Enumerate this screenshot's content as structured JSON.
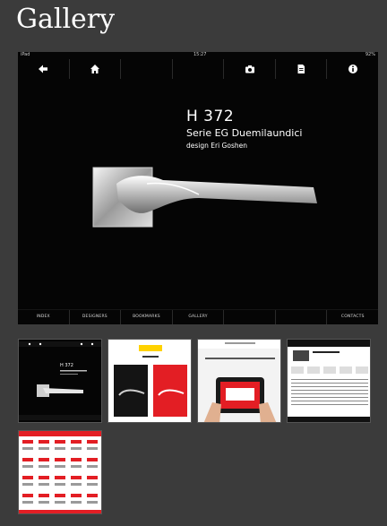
{
  "page": {
    "title": "Gallery"
  },
  "screenshot": {
    "status": {
      "left": "iPad",
      "center": "15:27",
      "right": "92%"
    },
    "toolbar": [
      {
        "name": "back-arrow-icon"
      },
      {
        "name": "home-icon"
      },
      {
        "name": "toolbar-blank-1"
      },
      {
        "name": "toolbar-blank-2"
      },
      {
        "name": "camera-icon"
      },
      {
        "name": "document-icon"
      },
      {
        "name": "info-icon"
      }
    ],
    "product": {
      "code": "H 372",
      "series": "Serie EG Duemilaundici",
      "designer": "design Eri Goshen"
    },
    "bottom_nav": [
      "INDEX",
      "DESIGNERS",
      "BOOKMARKS",
      "GALLERY",
      "",
      "",
      "CONTACTS"
    ]
  },
  "thumbnails": [
    {
      "name": "thumbnail-handle-detail",
      "h": "H 372"
    },
    {
      "name": "thumbnail-catalog-covers"
    },
    {
      "name": "thumbnail-ipad-hands"
    },
    {
      "name": "thumbnail-products-page"
    },
    {
      "name": "thumbnail-product-grid"
    }
  ],
  "colors": {
    "page_bg": "#3b3b3b",
    "screen_bg": "#050505",
    "accent_yellow": "#ffd200",
    "accent_red": "#e31e24"
  }
}
